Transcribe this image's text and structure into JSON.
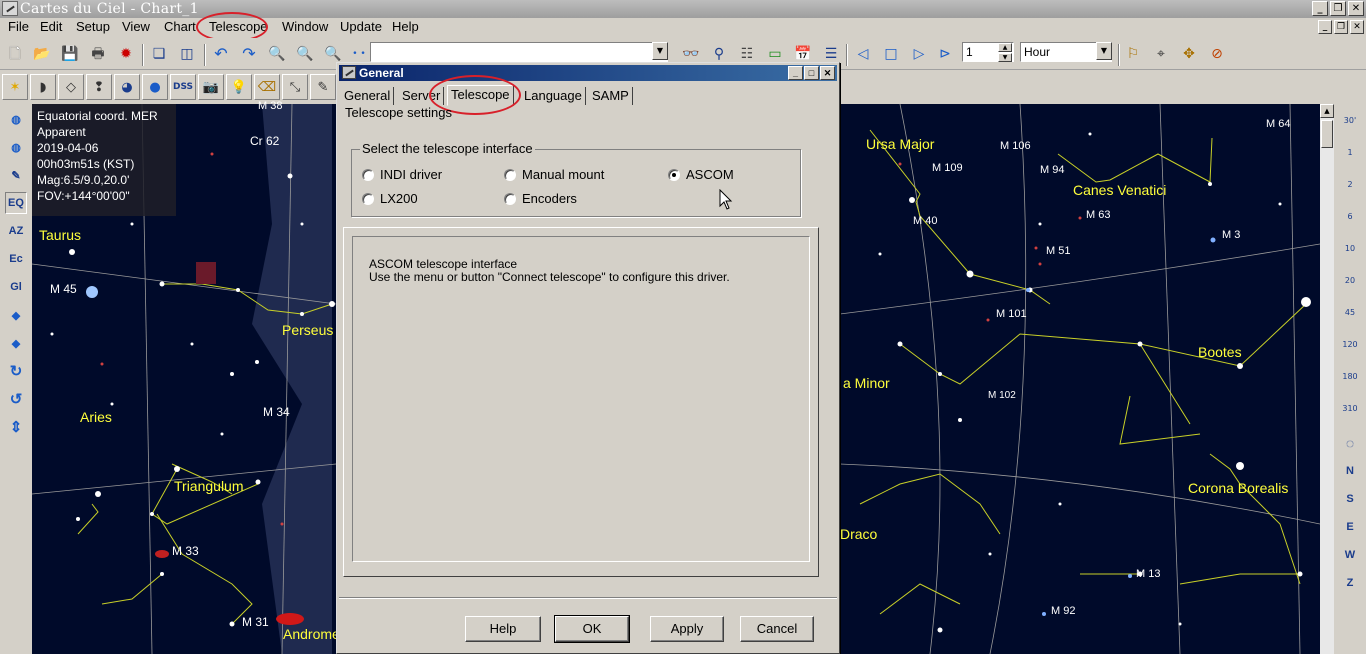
{
  "window": {
    "title": "Cartes du Ciel - Chart_1"
  },
  "menu": [
    "File",
    "Edit",
    "Setup",
    "View",
    "Chart",
    "Telescope",
    "Window",
    "Update",
    "Help"
  ],
  "toolbar": {
    "search_value": "",
    "step_value": "1",
    "time_unit": "Hour",
    "dss_label": "DSS"
  },
  "left_toolbar": [
    "EQ",
    "AZ",
    "Ec",
    "Gl"
  ],
  "right_toolbar": {
    "fov_labels": [
      "30'",
      "1",
      "2",
      "6",
      "10",
      "20",
      "45",
      "120",
      "180",
      "310"
    ],
    "directions": [
      "N",
      "S",
      "E",
      "W",
      "Z"
    ]
  },
  "chart_info": {
    "line1": "Equatorial coord. MER",
    "line2": "Apparent",
    "line3": "2019-04-06",
    "line4": "00h03m51s (KST)",
    "line5": "Mag:6.5/9.0,20.0'",
    "line6": "FOV:+144°00'00\""
  },
  "sky_left": {
    "constellations": [
      "Taurus",
      "Perseus",
      "Aries",
      "Triangulum",
      "Androme"
    ],
    "objects": [
      "M 38",
      "Cr 62",
      "M 45",
      "M 34",
      "M 33",
      "M 31"
    ]
  },
  "sky_right": {
    "constellations": [
      "Ursa Major",
      "Canes Venatici",
      "a Minor",
      "Bootes",
      "Corona Borealis",
      "Draco"
    ],
    "objects": [
      "M 64",
      "M 106",
      "M 109",
      "M 94",
      "M 63",
      "M 40",
      "M 3",
      "M 51",
      "M 101",
      "M 102",
      "M 13",
      "M 92"
    ]
  },
  "dialog": {
    "title": "General",
    "tabs": [
      "General",
      "Server",
      "Telescope",
      "Language",
      "SAMP"
    ],
    "subtitle": "Telescope settings",
    "group_label": "Select the telescope interface",
    "options": [
      "INDI driver",
      "Manual mount",
      "ASCOM",
      "LX200",
      "Encoders"
    ],
    "selected": "ASCOM",
    "description_line1": "ASCOM telescope interface",
    "description_line2": "Use the menu or button \"Connect telescope\" to configure this driver.",
    "buttons": {
      "help": "Help",
      "ok": "OK",
      "apply": "Apply",
      "cancel": "Cancel"
    }
  },
  "colors": {
    "sky": "#000a2a",
    "constellation_label": "#ffff3c",
    "annotation": "#d8202a"
  }
}
